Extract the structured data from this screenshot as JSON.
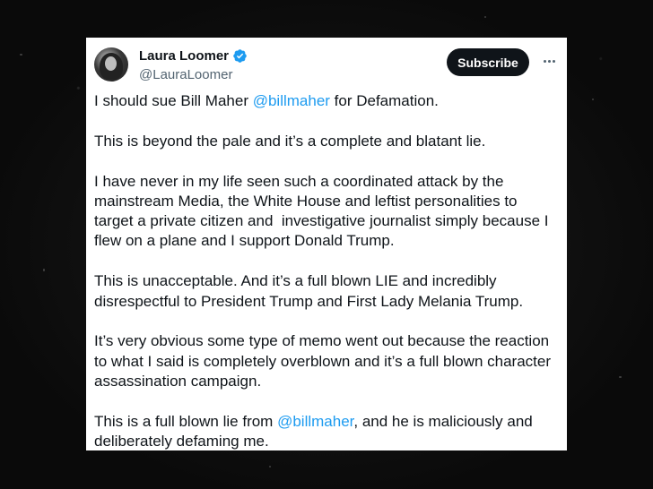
{
  "tweet": {
    "author_name": "Laura Loomer",
    "author_handle": "@LauraLoomer",
    "subscribe_label": "Subscribe",
    "paragraphs": [
      {
        "before": "I should sue Bill Maher ",
        "mention": "@billmaher",
        "after": " for Defamation."
      },
      {
        "text": "This is beyond the pale and it’s a complete and blatant lie."
      },
      {
        "text": "I have never in my life seen such a coordinated attack by the mainstream Media, the White House and leftist personalities to target a private citizen and  investigative journalist simply because I flew on a plane and I support Donald Trump."
      },
      {
        "text": "This is unacceptable. And it’s a full blown LIE and incredibly disrespectful to President Trump and First Lady Melania Trump."
      },
      {
        "text": "It’s very obvious some type of memo went out because the reaction to what I said is completely overblown and it’s a full blown character assassination campaign."
      },
      {
        "before": "This is a full blown lie from ",
        "mention": "@billmaher",
        "after": ", and he is maliciously and deliberately defaming me."
      }
    ]
  },
  "colors": {
    "mention": "#1d9bf0",
    "verified_badge": "#1d9bf0",
    "subscribe_bg": "#0f1419"
  },
  "icons": {
    "verified": "verified-badge-icon",
    "more": "more-dots-icon"
  }
}
